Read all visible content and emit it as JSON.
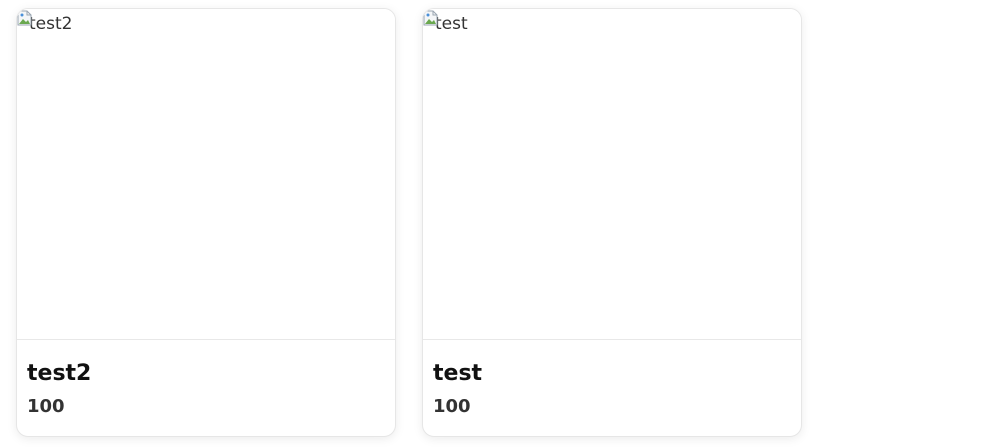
{
  "products": [
    {
      "image_alt": "test2",
      "title": "test2",
      "price": "100"
    },
    {
      "image_alt": "test",
      "title": "test",
      "price": "100"
    }
  ],
  "icons": {
    "broken_image": "broken-image-icon"
  }
}
